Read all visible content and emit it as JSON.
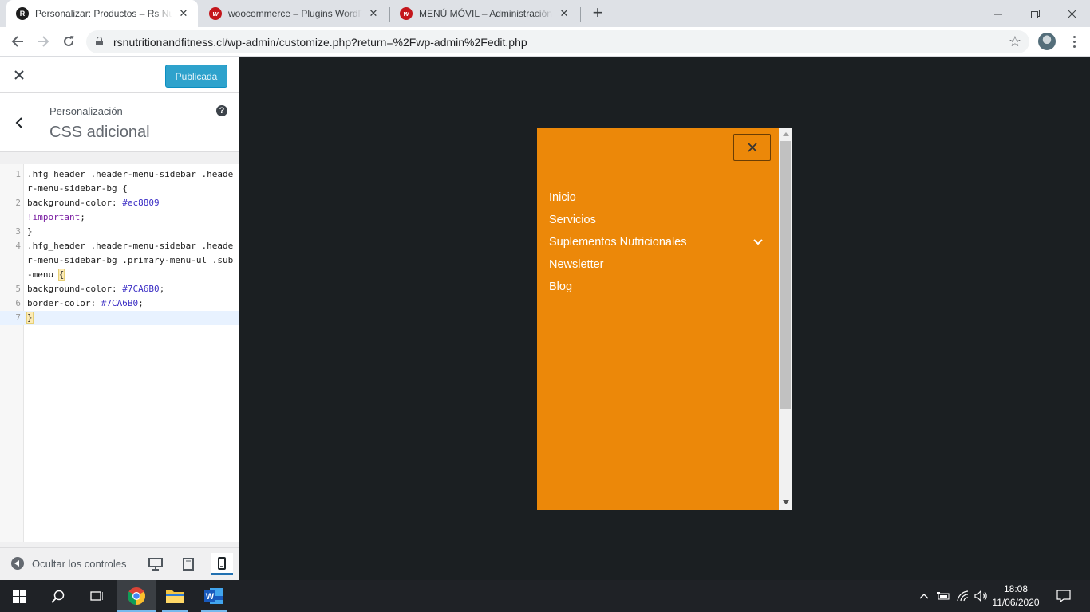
{
  "browser": {
    "tabs": [
      {
        "title": "Personalizar: Productos – Rs Nutrition",
        "favicon": "rs-favicon",
        "active": true
      },
      {
        "title": "woocommerce – Plugins WordPress",
        "favicon": "w-favicon",
        "active": false
      },
      {
        "title": "MENÚ MÓVIL – Administración WordPress",
        "favicon": "w-favicon",
        "active": false
      }
    ],
    "new_tab": "+",
    "url": "rsnutritionandfitness.cl/wp-admin/customize.php?return=%2Fwp-admin%2Fedit.php"
  },
  "customizer": {
    "publish_label": "Publicada",
    "breadcrumb": "Personalización",
    "section_title": "CSS adicional",
    "help": "?",
    "code_lines": [
      {
        "num": "1",
        "text": ".hfg_header .header-menu-sidebar .header-menu-sidebar-bg {"
      },
      {
        "num": "2",
        "prefix": "background-color: ",
        "hex": "#ec8809",
        "imp": "!important",
        "suffix": ";"
      },
      {
        "num": "3",
        "text": "}"
      },
      {
        "num": "4",
        "text": ".hfg_header .header-menu-sidebar .header-menu-sidebar-bg .primary-menu-ul .sub-menu ",
        "brace": "{"
      },
      {
        "num": "5",
        "prefix": "background-color: ",
        "hex": "#7CA6B0",
        "suffix": ";"
      },
      {
        "num": "6",
        "prefix": "border-color: ",
        "hex": "#7CA6B0",
        "suffix": ";"
      },
      {
        "num": "7",
        "brace": "}"
      }
    ],
    "hide_controls_label": "Ocultar los controles",
    "devices": [
      "desktop",
      "tablet",
      "mobile"
    ],
    "active_device": "mobile"
  },
  "preview": {
    "menu_bg_color": "#ec8809",
    "close_icon": "×",
    "menu_items": [
      {
        "label": "Inicio"
      },
      {
        "label": "Servicios"
      },
      {
        "label": "Suplementos Nutricionales",
        "has_submenu": true
      },
      {
        "label": "Newsletter"
      },
      {
        "label": "Blog"
      }
    ]
  },
  "taskbar": {
    "apps": [
      "start",
      "search",
      "task-view",
      "chrome",
      "file-explorer",
      "word"
    ],
    "time": "18:08",
    "date": "11/06/2020"
  },
  "colors": {
    "accent_blue": "#2ea2cc",
    "preview_bg": "#1b1f22",
    "taskbar_bg": "#1f2226"
  }
}
